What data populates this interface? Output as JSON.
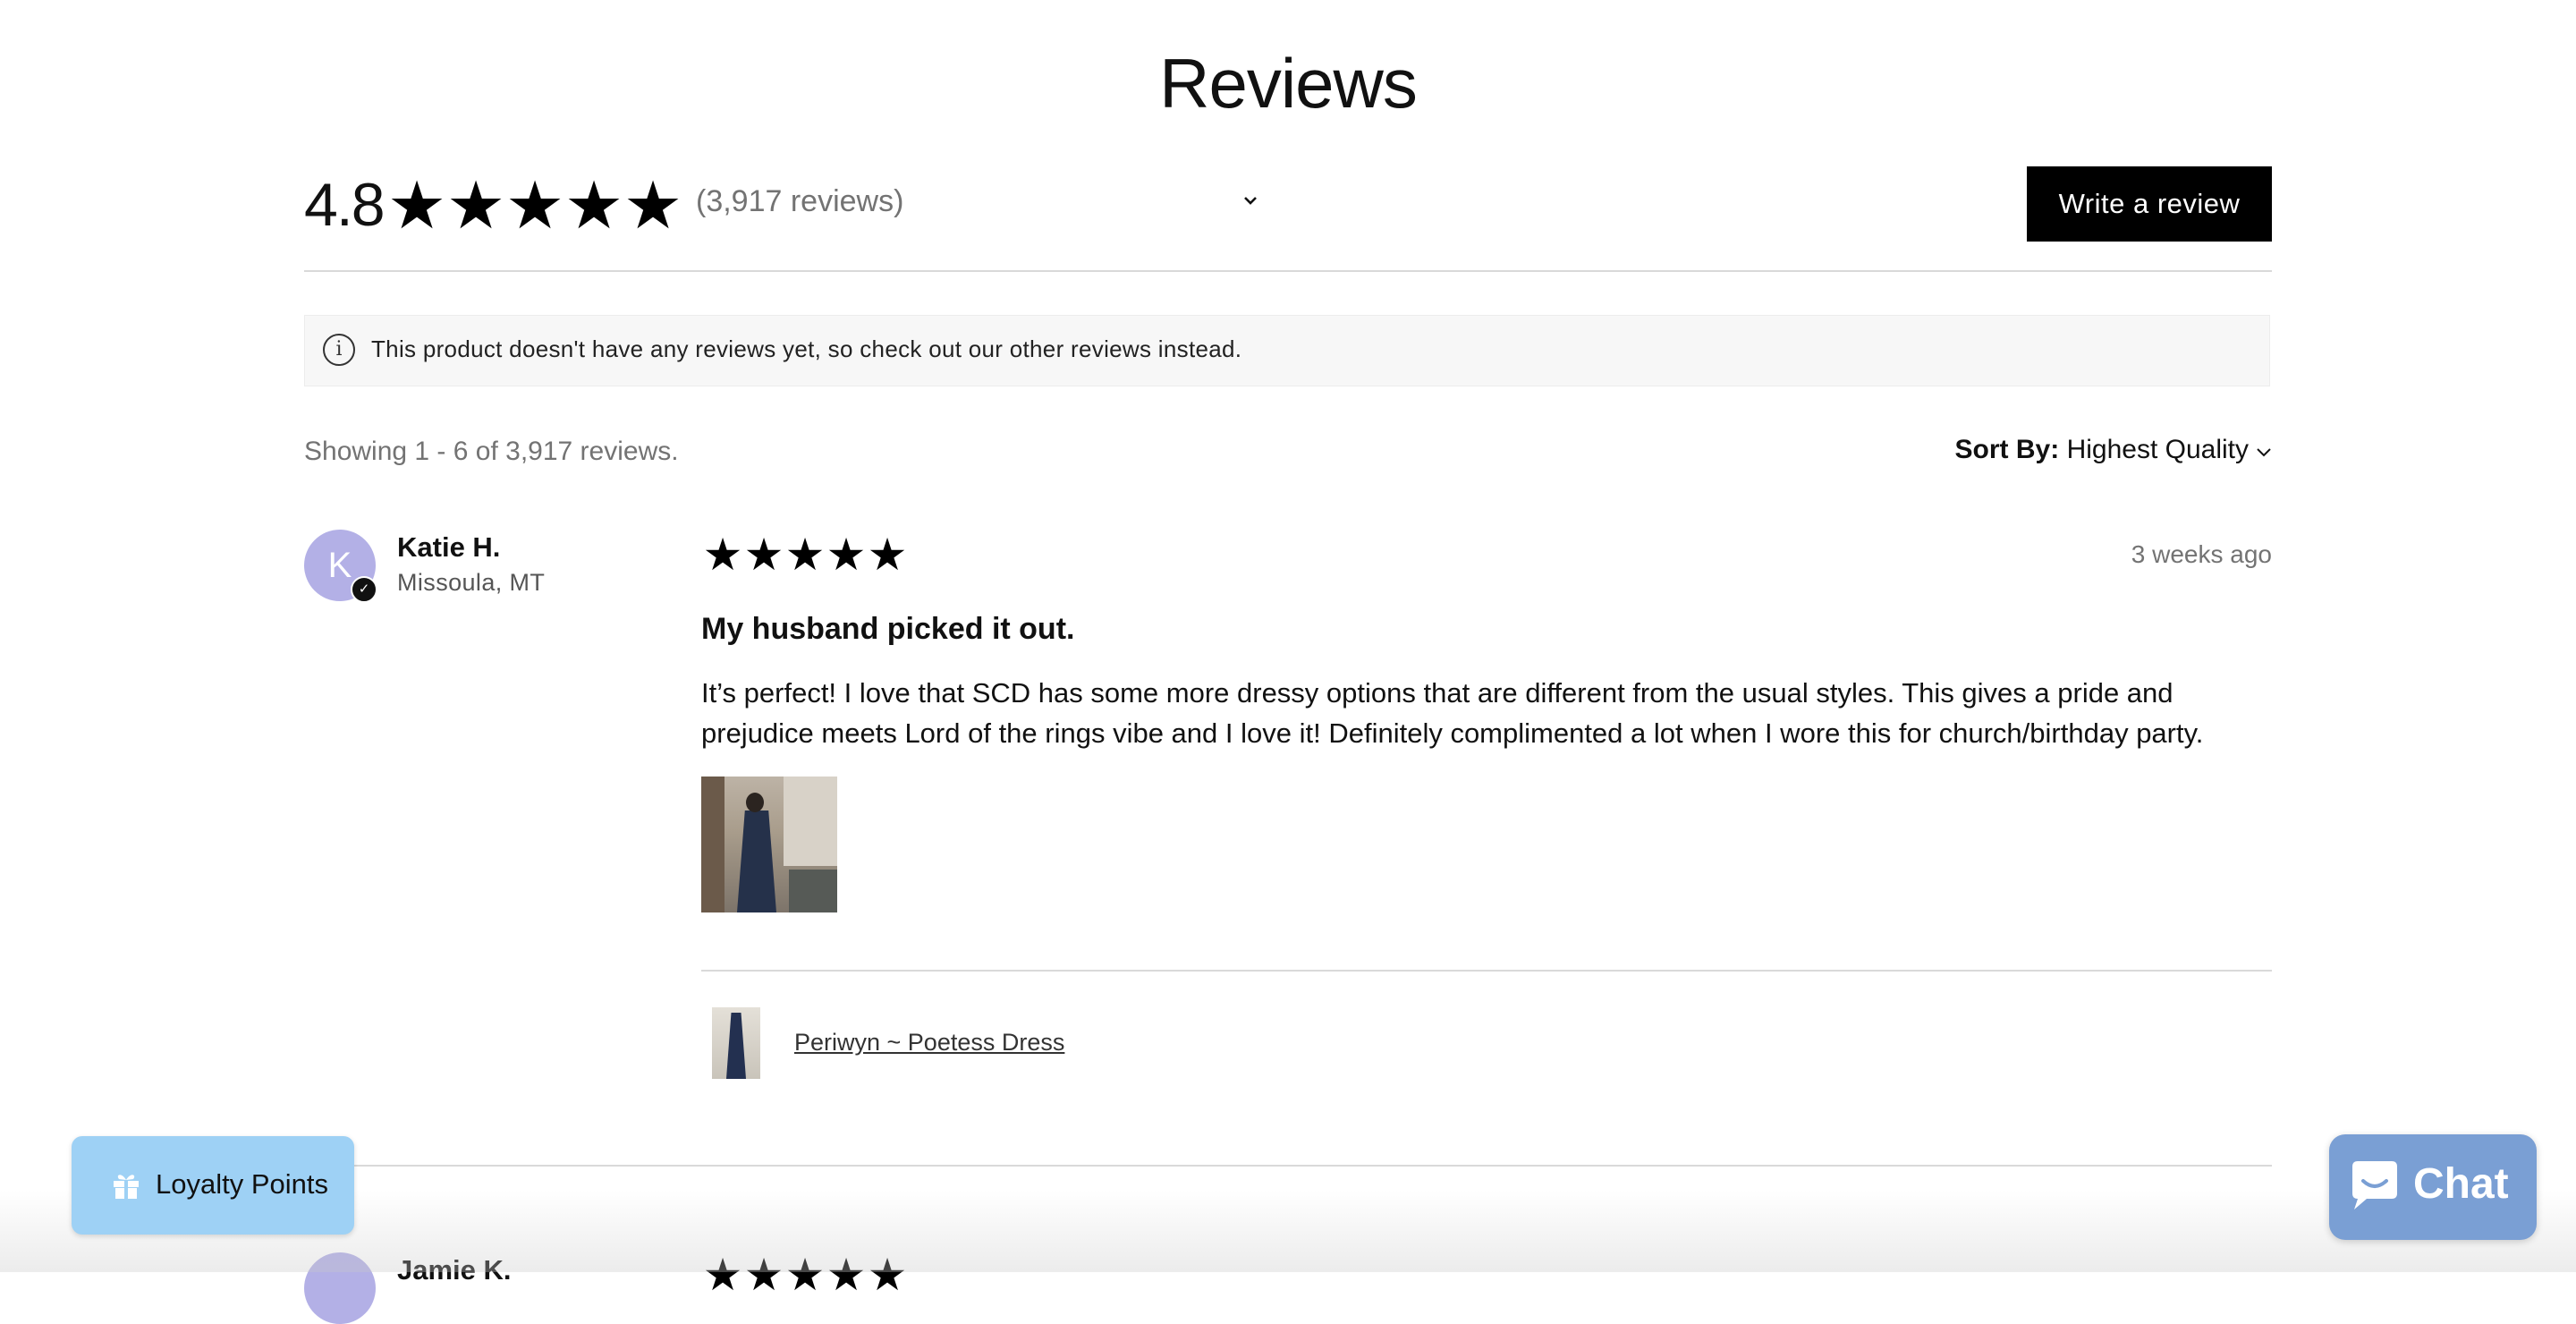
{
  "header": {
    "title": "Reviews"
  },
  "summary": {
    "average": "4.8",
    "stars": [
      "★",
      "★",
      "★",
      "★",
      "★"
    ],
    "rating": 4.8,
    "count_text": "(3,917 reviews)",
    "write_label": "Write a review"
  },
  "notice": {
    "text": "This product doesn't have any reviews yet, so check out our other reviews instead."
  },
  "list_meta": {
    "showing": "Showing 1 - 6 of 3,917 reviews.",
    "sort_label": "Sort By:",
    "sort_value": "Highest Quality"
  },
  "reviews": [
    {
      "initial": "K",
      "author": "Katie H.",
      "location": "Missoula, MT",
      "stars": [
        "★",
        "★",
        "★",
        "★",
        "★"
      ],
      "rating": 5,
      "date": "3 weeks ago",
      "title": "My husband picked it out.",
      "body": "It’s perfect! I love that SCD has some more dressy options that are different from the usual styles. This gives a pride and prejudice meets Lord of the rings vibe and I love it! Definitely complimented a lot when I wore this for church/birthday party.",
      "product_name": "Periwyn ~ Poetess Dress"
    },
    {
      "author": "Jamie K.",
      "stars": [
        "★",
        "★",
        "★",
        "★",
        "★"
      ]
    }
  ],
  "widgets": {
    "loyalty_label": "Loyalty Points",
    "chat_label": "Chat"
  },
  "colors": {
    "accent": "#000000",
    "avatar": "#b3b0e6",
    "loyalty": "#9ed1f5",
    "chat": "#7a9fd4",
    "muted_text": "#737373"
  }
}
